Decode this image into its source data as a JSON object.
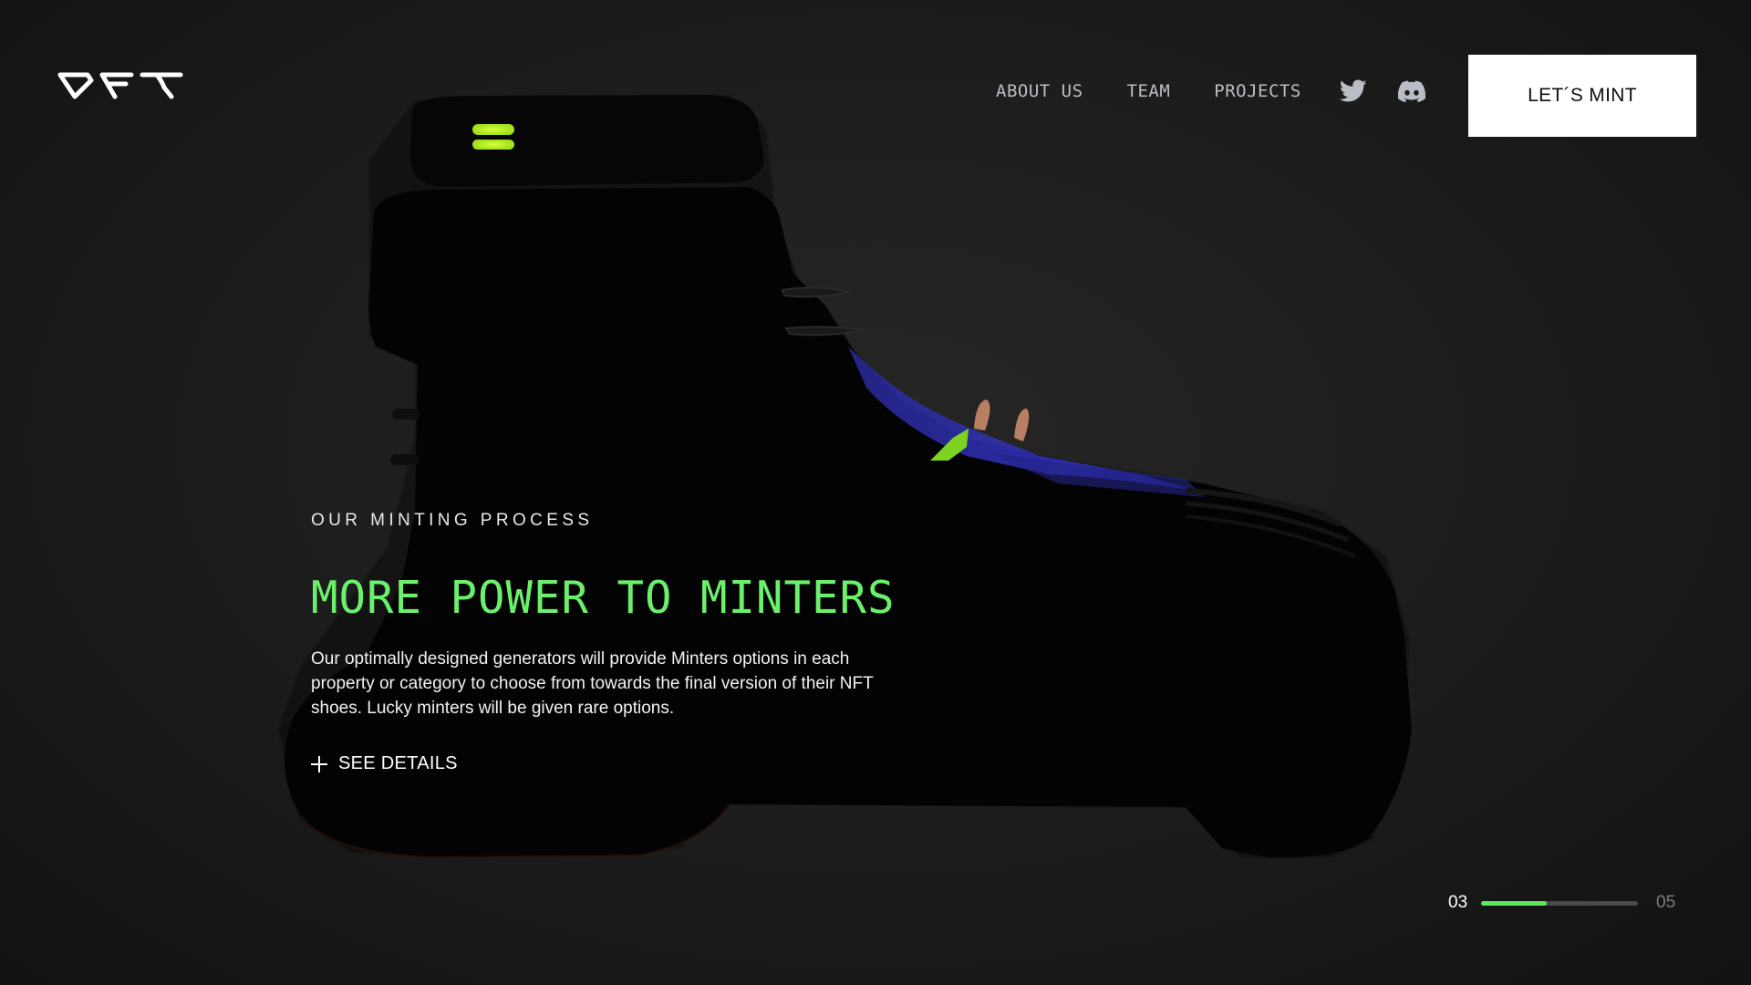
{
  "brand": {
    "logo_text": "OFT",
    "accent_color": "#6cf06c"
  },
  "nav": {
    "items": [
      {
        "label": "ABOUT US"
      },
      {
        "label": "TEAM"
      },
      {
        "label": "PROJECTS"
      }
    ],
    "social": [
      {
        "icon": "twitter-icon"
      },
      {
        "icon": "discord-icon"
      }
    ],
    "cta_label": "LET´S MINT"
  },
  "hero": {
    "eyebrow": "OUR MINTING PROCESS",
    "headline": "MORE POWER TO MINTERS",
    "description": "Our optimally designed generators will provide Minters options in each property or category to choose from towards the final version of their NFT shoes. Lucky minters will be given rare options.",
    "details_label": "SEE DETAILS",
    "details_icon": "plus-icon",
    "image": "sneaker-boot-image"
  },
  "pager": {
    "current": "03",
    "total": "05",
    "progress": 0.42
  }
}
